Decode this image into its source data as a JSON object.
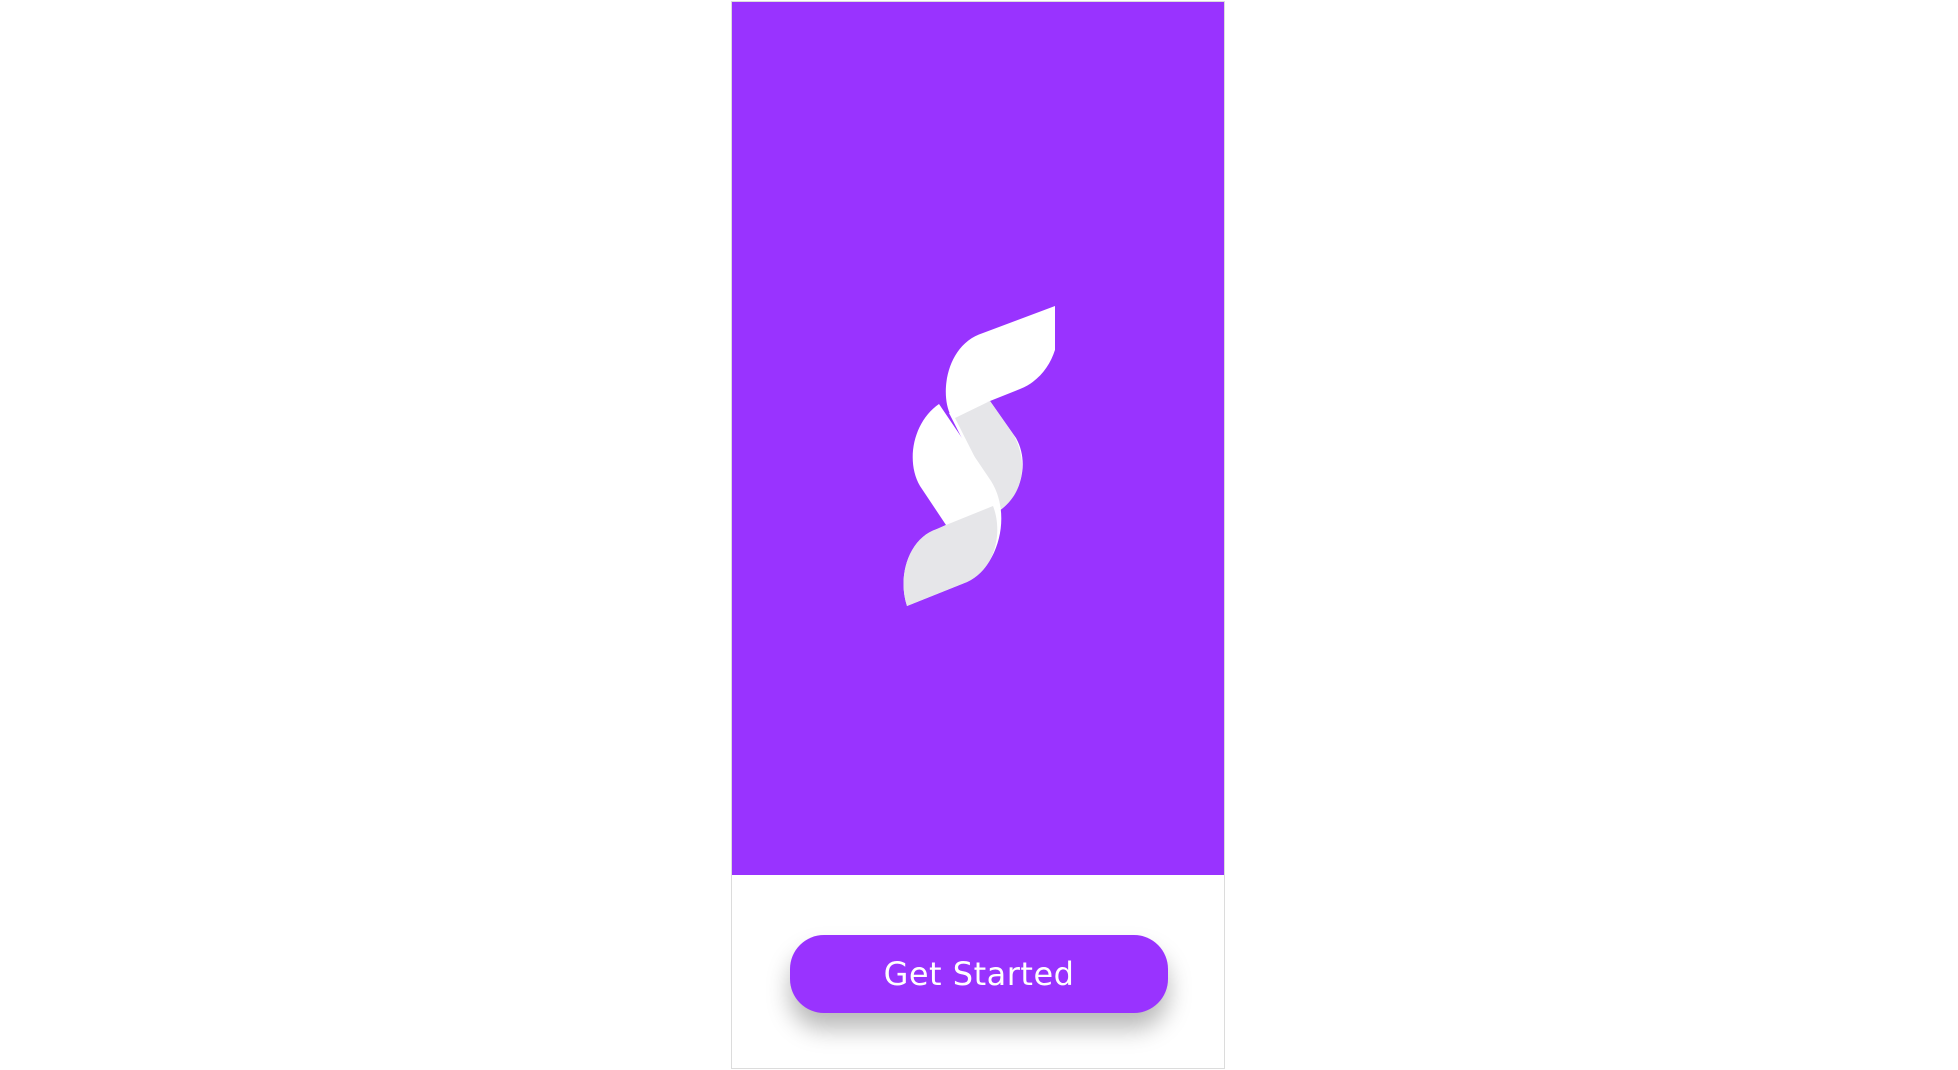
{
  "app": {
    "logo_icon": "brand-s-logo-icon",
    "brand_color": "#9933FF",
    "logo_colors": {
      "light": "#FFFFFF",
      "shade": "#E6E6E9"
    }
  },
  "actions": {
    "get_started_label": "Get Started"
  }
}
